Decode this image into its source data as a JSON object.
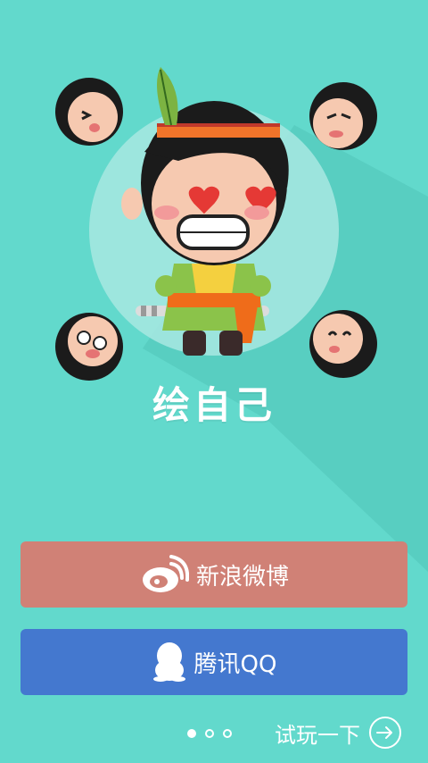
{
  "app": {
    "title": "绘自己"
  },
  "buttons": {
    "weibo": {
      "label": "新浪微博",
      "icon": "weibo-icon",
      "color": "#d08176"
    },
    "qq": {
      "label": "腾讯QQ",
      "icon": "qq-penguin-icon",
      "color": "#4478cf"
    }
  },
  "pager": {
    "pages": 3,
    "active": 1
  },
  "try_link": {
    "label": "试玩一下",
    "icon": "arrow-right-circle-icon"
  },
  "colors": {
    "background": "#62d9cc",
    "accent_white": "#ffffff"
  }
}
